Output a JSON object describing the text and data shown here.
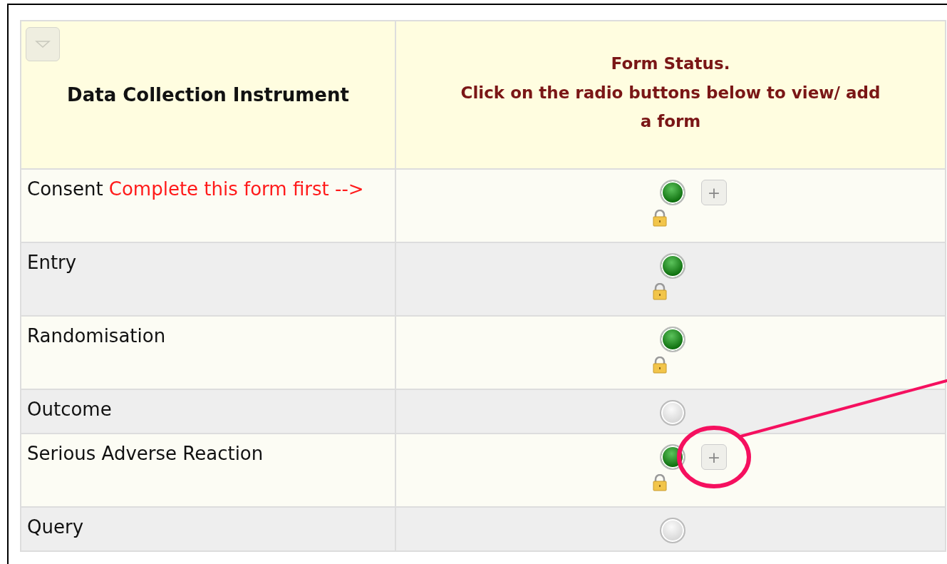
{
  "table": {
    "collapse_button": true,
    "columns": [
      {
        "title": "Data Collection Instrument"
      },
      {
        "title": "Form Status.",
        "note": "Click on the radio buttons below to view/ add a form"
      }
    ],
    "rows": [
      {
        "name": "Consent",
        "note": "Complete this form first -->",
        "complete": true,
        "locked": true,
        "add_button": "+"
      },
      {
        "name": "Entry",
        "complete": true,
        "locked": true
      },
      {
        "name": "Randomisation",
        "complete": true,
        "locked": true
      },
      {
        "name": "Outcome",
        "complete": false,
        "locked": false
      },
      {
        "name": "Serious Adverse Reaction",
        "complete": true,
        "locked": true,
        "add_button": "+",
        "highlighted": true
      },
      {
        "name": "Query",
        "complete": false,
        "locked": false
      }
    ]
  }
}
